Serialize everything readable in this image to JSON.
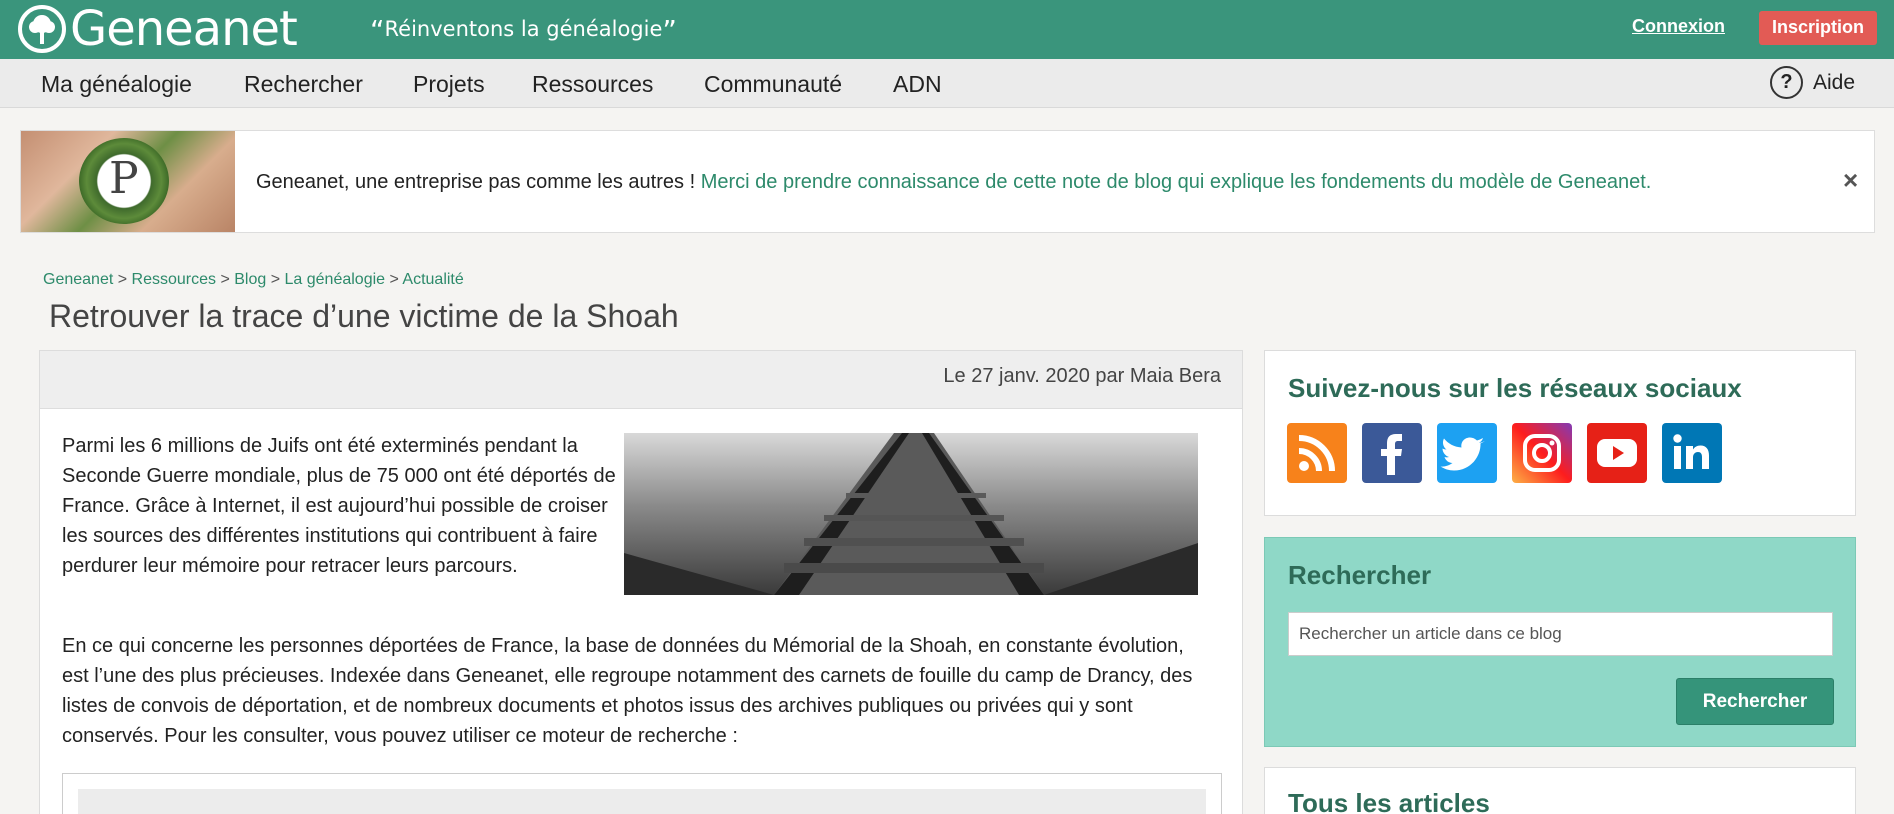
{
  "header": {
    "logo_text": "Geneanet",
    "tagline_open": "“",
    "tagline": "Réinventons la généalogie",
    "tagline_close": "”",
    "login": "Connexion",
    "signup": "Inscription"
  },
  "nav": {
    "items": [
      "Ma généalogie",
      "Rechercher",
      "Projets",
      "Ressources",
      "Communauté",
      "ADN"
    ],
    "help": "Aide",
    "help_symbol": "?"
  },
  "banner": {
    "image_letter": "P",
    "text": "Geneanet, une entreprise pas comme les autres !",
    "link": "Merci de prendre connaissance de cette note de blog qui explique les fondements du modèle de Geneanet.",
    "close": "×"
  },
  "breadcrumb": [
    "Geneanet",
    "Ressources",
    "Blog",
    "La généalogie",
    "Actualité"
  ],
  "breadcrumb_sep": " > ",
  "article": {
    "title": "Retrouver la trace d’une victime de la Shoah",
    "meta": "Le 27 janv. 2020 par Maia Bera",
    "para1": "Parmi les 6 millions de Juifs ont été exterminés pendant la Seconde Guerre mondiale, plus de 75 000 ont été déportés de France. Grâce à Internet, il est aujourd’hui possible de croiser les sources des différentes institutions qui contribuent à faire perdurer leur mémoire pour retracer leurs parcours.",
    "para2": "En ce qui concerne les personnes déportées de France, la base de données du Mémorial de la Shoah, en constante évolution, est l’une des plus précieuses. Indexée dans Geneanet, elle regroupe notamment des carnets de fouille du camp de Drancy, des listes de convois de déportation, et de nombreux documents et photos issus des archives publiques ou privées qui y sont conservés. Pour les consulter, vous pouvez utiliser ce moteur de recherche :"
  },
  "sidebar": {
    "social_title": "Suivez-nous sur les réseaux sociaux",
    "social_icons": [
      {
        "name": "rss-icon",
        "color": "#f7821b"
      },
      {
        "name": "facebook-icon",
        "color": "#3b5998"
      },
      {
        "name": "twitter-icon",
        "color": "#1da1f2"
      },
      {
        "name": "instagram-icon",
        "color": "#d6249f"
      },
      {
        "name": "youtube-icon",
        "color": "#e62117"
      },
      {
        "name": "linkedin-icon",
        "color": "#0077b5"
      }
    ],
    "search_title": "Rechercher",
    "search_placeholder": "Rechercher un article dans ce blog",
    "search_button": "Rechercher",
    "articles_title": "Tous les articles"
  },
  "colors": {
    "brand": "#3a957c",
    "signup": "#e25b55",
    "link": "#2d8a6b",
    "search_panel": "#8fd8c7"
  }
}
